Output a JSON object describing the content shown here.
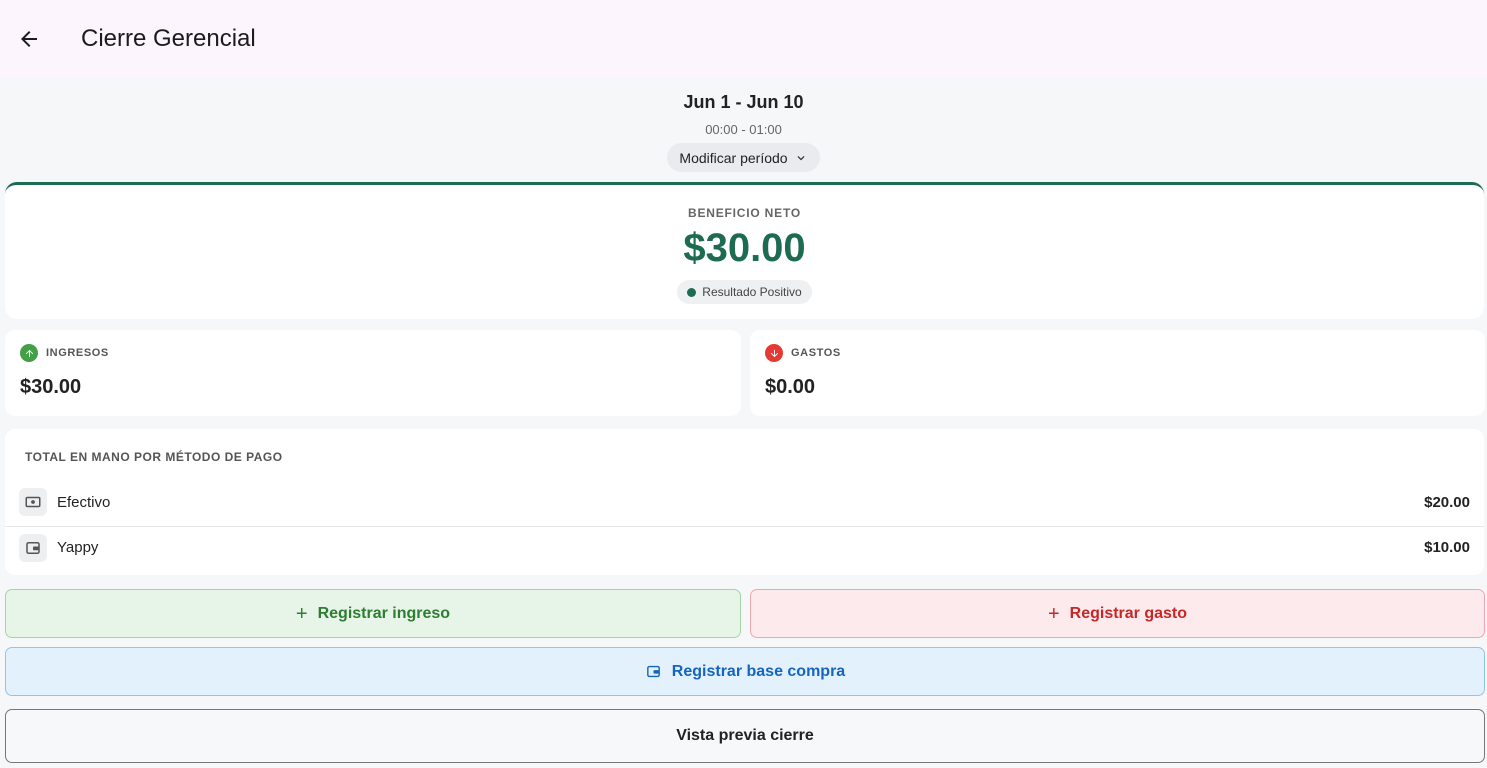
{
  "appbar": {
    "title": "Cierre Gerencial"
  },
  "period": {
    "range": "Jun 1 - Jun 10",
    "time": "00:00 - 01:00",
    "modify_label": "Modificar período"
  },
  "net": {
    "label": "BENEFICIO NETO",
    "value": "$30.00",
    "status": "Resultado Positivo",
    "color": "#1d6b50"
  },
  "income": {
    "label": "INGRESOS",
    "value": "$30.00",
    "color": "#43a047"
  },
  "expenses": {
    "label": "GASTOS",
    "value": "$0.00",
    "color": "#e53935"
  },
  "methods": {
    "title": "TOTAL EN MANO POR MÉTODO DE PAGO",
    "items": [
      {
        "name": "Efectivo",
        "amount": "$20.00",
        "icon": "cash-icon"
      },
      {
        "name": "Yappy",
        "amount": "$10.00",
        "icon": "wallet-icon"
      }
    ]
  },
  "actions": {
    "income_label": "Registrar ingreso",
    "expense_label": "Registrar gasto",
    "base_label": "Registrar base compra",
    "preview_label": "Vista previa cierre"
  }
}
